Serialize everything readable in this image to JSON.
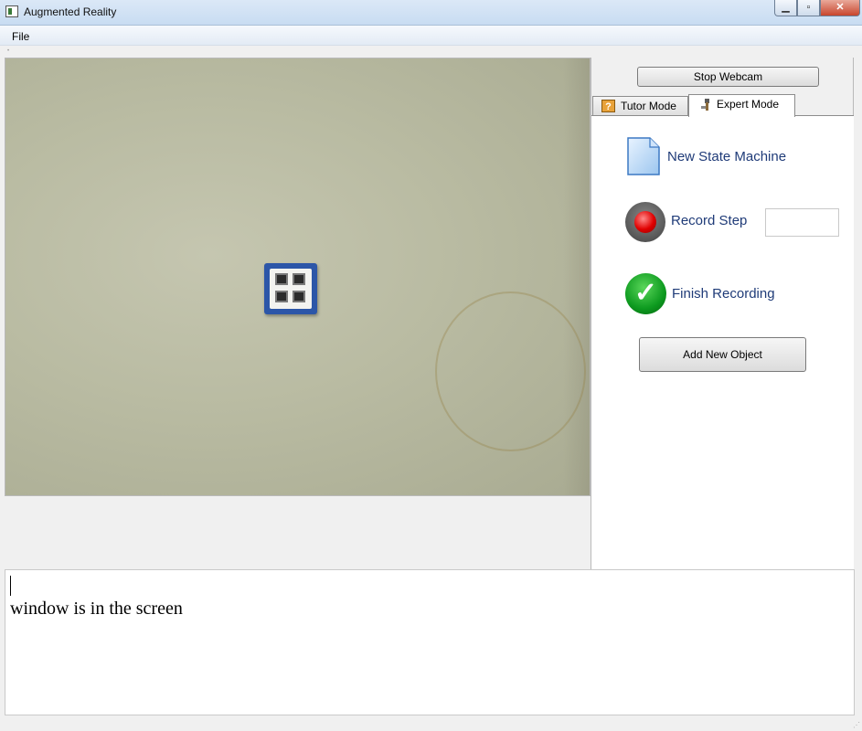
{
  "window": {
    "title": "Augmented Reality"
  },
  "menu": {
    "items": [
      "File"
    ]
  },
  "panel": {
    "stop_webcam_label": "Stop Webcam",
    "tabs": [
      {
        "label": "Tutor Mode",
        "icon": "question-icon"
      },
      {
        "label": "Expert Mode",
        "icon": "expert-icon",
        "active": true
      }
    ],
    "expert": {
      "new_state_machine": "New State Machine",
      "record_step": "Record Step",
      "record_step_value": "",
      "finish_recording": "Finish Recording",
      "add_new_object": "Add New Object"
    }
  },
  "console": {
    "text": "window is in the screen"
  }
}
